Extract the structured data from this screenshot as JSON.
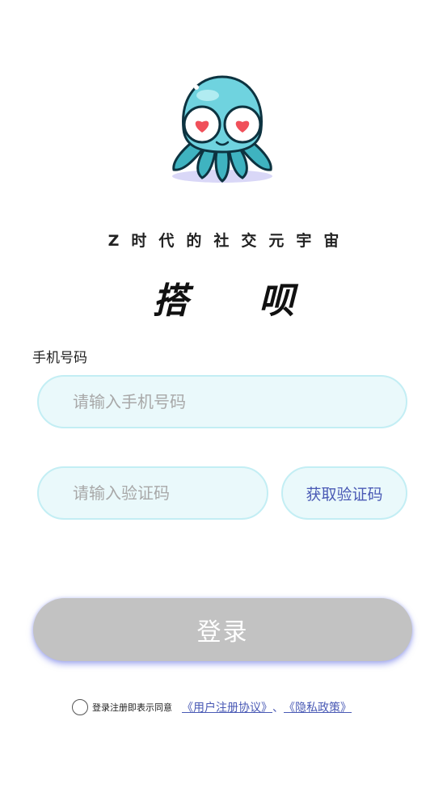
{
  "header": {
    "tagline": "Z时代的社交元宇宙",
    "brand": "搭 呗"
  },
  "form": {
    "phone_label": "手机号码",
    "phone_placeholder": "请输入手机号码",
    "phone_value": "",
    "code_placeholder": "请输入验证码",
    "code_value": "",
    "get_code_label": "获取验证码",
    "login_label": "登录"
  },
  "agreement": {
    "checked": false,
    "text": "登录注册即表示同意",
    "user_agreement": "《用户注册协议》",
    "separator": "、",
    "privacy_policy": "《隐私政策》"
  },
  "colors": {
    "mascot_body": "#6fd3df",
    "input_bg": "#eaf9fb",
    "input_border": "#c3eef4",
    "link": "#4a5ab5",
    "login_disabled": "#c2c2c2"
  },
  "icons": [
    "octopus-mascot-logo",
    "radio-unchecked-icon"
  ]
}
